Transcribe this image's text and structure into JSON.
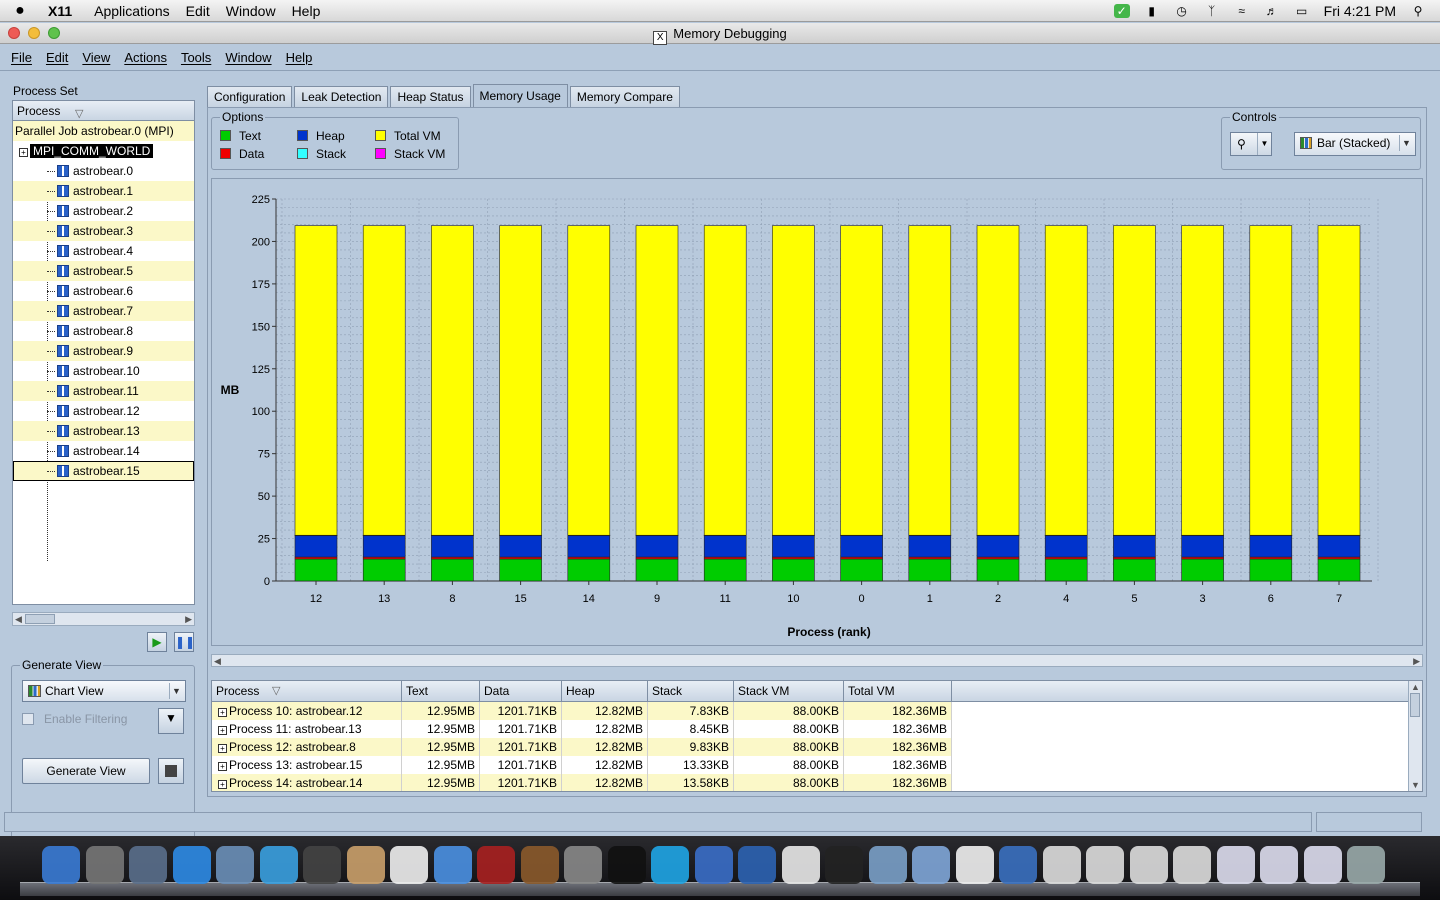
{
  "menubar": {
    "app": "X11",
    "items": [
      "Applications",
      "Edit",
      "Window",
      "Help"
    ],
    "clock": "Fri 4:21 PM"
  },
  "window": {
    "title": "Memory Debugging"
  },
  "appmenu": [
    "File",
    "Edit",
    "View",
    "Actions",
    "Tools",
    "Window",
    "Help"
  ],
  "left": {
    "process_set_label": "Process Set",
    "tree_header": "Process",
    "job": "Parallel Job astrobear.0 (MPI)",
    "comm": "MPI_COMM_WORLD",
    "processes": [
      "astrobear.0",
      "astrobear.1",
      "astrobear.2",
      "astrobear.3",
      "astrobear.4",
      "astrobear.5",
      "astrobear.6",
      "astrobear.7",
      "astrobear.8",
      "astrobear.9",
      "astrobear.10",
      "astrobear.11",
      "astrobear.12",
      "astrobear.13",
      "astrobear.14",
      "astrobear.15"
    ],
    "selected": "astrobear.15"
  },
  "generate": {
    "label": "Generate View",
    "view_select": "Chart View",
    "filter_label": "Enable Filtering",
    "button": "Generate View"
  },
  "tabs": [
    "Configuration",
    "Leak Detection",
    "Heap Status",
    "Memory Usage",
    "Memory Compare"
  ],
  "active_tab": "Memory Usage",
  "options": {
    "label": "Options",
    "legend": [
      {
        "name": "Text",
        "color": "#00cc00"
      },
      {
        "name": "Data",
        "color": "#ee0000"
      },
      {
        "name": "Heap",
        "color": "#0033cc"
      },
      {
        "name": "Stack",
        "color": "#33ffff"
      },
      {
        "name": "Total VM",
        "color": "#ffff00"
      },
      {
        "name": "Stack VM",
        "color": "#ff00ff"
      }
    ]
  },
  "controls": {
    "label": "Controls",
    "chart_type": "Bar (Stacked)"
  },
  "chart_data": {
    "type": "bar",
    "stacked": true,
    "categories": [
      "12",
      "13",
      "8",
      "15",
      "14",
      "9",
      "11",
      "10",
      "0",
      "1",
      "2",
      "4",
      "5",
      "3",
      "6",
      "7"
    ],
    "series": [
      {
        "name": "Text",
        "color": "#00cc00",
        "values": [
          12.95,
          12.95,
          12.95,
          12.95,
          12.95,
          12.95,
          12.95,
          12.95,
          12.95,
          12.95,
          12.95,
          12.95,
          12.95,
          12.95,
          12.95,
          12.95
        ]
      },
      {
        "name": "Data",
        "color": "#ee0000",
        "values": [
          1.17,
          1.17,
          1.17,
          1.17,
          1.17,
          1.17,
          1.17,
          1.17,
          1.17,
          1.17,
          1.17,
          1.17,
          1.17,
          1.17,
          1.17,
          1.17
        ]
      },
      {
        "name": "Heap",
        "color": "#0033cc",
        "values": [
          12.82,
          12.82,
          12.82,
          12.82,
          12.82,
          12.82,
          12.82,
          12.82,
          12.82,
          12.82,
          12.82,
          12.82,
          12.82,
          12.82,
          12.82,
          12.82
        ]
      },
      {
        "name": "Stack",
        "color": "#33ffff",
        "values": [
          0.01,
          0.01,
          0.01,
          0.01,
          0.01,
          0.01,
          0.01,
          0.01,
          0.01,
          0.01,
          0.01,
          0.01,
          0.01,
          0.01,
          0.01,
          0.01
        ]
      },
      {
        "name": "Total VM",
        "color": "#ffff00",
        "values": [
          182.36,
          182.36,
          182.36,
          182.36,
          182.36,
          182.36,
          182.36,
          182.36,
          182.36,
          182.36,
          182.36,
          182.36,
          182.36,
          182.36,
          182.36,
          182.36
        ]
      }
    ],
    "xlabel": "Process (rank)",
    "ylabel": "MB",
    "ylim": [
      0,
      225
    ],
    "yticks": [
      0,
      25,
      50,
      75,
      100,
      125,
      150,
      175,
      200,
      225
    ],
    "grid": true
  },
  "table": {
    "headers": [
      "Process",
      "Text",
      "Data",
      "Heap",
      "Stack",
      "Stack VM",
      "Total VM"
    ],
    "rows": [
      [
        "Process 10: astrobear.12",
        "12.95MB",
        "1201.71KB",
        "12.82MB",
        "7.83KB",
        "88.00KB",
        "182.36MB"
      ],
      [
        "Process 11: astrobear.13",
        "12.95MB",
        "1201.71KB",
        "12.82MB",
        "8.45KB",
        "88.00KB",
        "182.36MB"
      ],
      [
        "Process 12: astrobear.8",
        "12.95MB",
        "1201.71KB",
        "12.82MB",
        "9.83KB",
        "88.00KB",
        "182.36MB"
      ],
      [
        "Process 13: astrobear.15",
        "12.95MB",
        "1201.71KB",
        "12.82MB",
        "13.33KB",
        "88.00KB",
        "182.36MB"
      ],
      [
        "Process 14: astrobear.14",
        "12.95MB",
        "1201.71KB",
        "12.82MB",
        "13.58KB",
        "88.00KB",
        "182.36MB"
      ]
    ]
  }
}
